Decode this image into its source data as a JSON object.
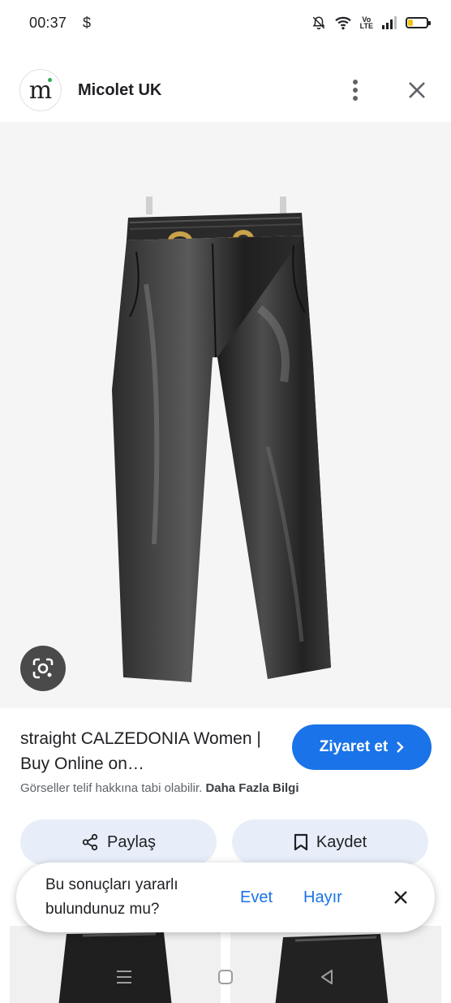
{
  "status_bar": {
    "time": "00:37",
    "dollar": "$",
    "icons": [
      "mute-bell-icon",
      "wifi-icon",
      "volte-icon",
      "signal-icon",
      "battery-icon"
    ],
    "volte_text_top": "Vo",
    "volte_text_bottom": "LTE",
    "battery_level": 0.25,
    "battery_color": "#f4c20d"
  },
  "header": {
    "avatar_letter": "m",
    "site_name": "Micolet UK"
  },
  "result": {
    "title": "straight CALZEDONIA Women | Buy Online on…",
    "visit_label": "Ziyaret et",
    "copyright_text": "Görseller telif hakkına tabi olabilir.",
    "copyright_link": "Daha Fazla Bilgi"
  },
  "actions": {
    "share_label": "Paylaş",
    "save_label": "Kaydet"
  },
  "feedback": {
    "question": "Bu sonuçları yararlı bulundunuz mu?",
    "yes_label": "Evet",
    "no_label": "Hayır"
  },
  "colors": {
    "accent": "#1a73e8",
    "pill_bg": "#e8eef9",
    "image_bg": "#f5f5f5"
  }
}
